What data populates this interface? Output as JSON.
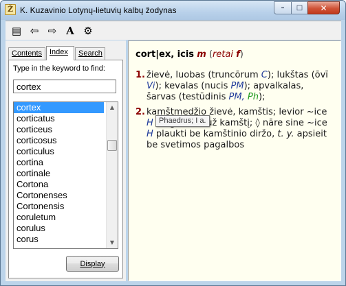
{
  "window": {
    "title": "K. Kuzavinio Lotynų-lietuvių kalbų žodynas",
    "icon_glyph": "Ž",
    "controls": {
      "minimize": "–",
      "maximize": "□",
      "close": "✕"
    }
  },
  "toolbar": [
    {
      "name": "toggle-pane-icon",
      "glyph": "▤"
    },
    {
      "name": "back-arrow-icon",
      "glyph": "⇦"
    },
    {
      "name": "forward-arrow-icon",
      "glyph": "⇨"
    },
    {
      "name": "font-size-icon",
      "glyph": "A"
    },
    {
      "name": "options-icon",
      "glyph": "⚙"
    }
  ],
  "tabs": {
    "contents": "Contents",
    "index": "Index",
    "search": "Search"
  },
  "index": {
    "prompt": "Type in the keyword to find:",
    "keyword_value": "cortex",
    "items": [
      "cortex",
      "corticatus",
      "corticeus",
      "corticosus",
      "corticulus",
      "cortina",
      "cortinale",
      "Cortona",
      "Cortonenses",
      "Cortonensis",
      "coruletum",
      "corulus",
      "corus"
    ],
    "selected_index": 0,
    "display_label": "Display"
  },
  "entry": {
    "headword": "cort|ex, icis",
    "gender": "m",
    "paren_open": "(",
    "paren_word": "retai",
    "paren_gender": "f",
    "paren_close": ")",
    "senses": [
      {
        "num": "1.",
        "text_a": "žievė, luobas (truncōrum ",
        "auth_a": "C",
        "text_b": "); lukštas (ōvī ",
        "auth_b": "Vi",
        "text_c": "); kevalas (nucis ",
        "auth_c": "PM",
        "text_d": "); apvalkalas, šarvas (testūdinis ",
        "auth_d": "PM,",
        "auth_e": "Ph",
        "text_e": ");"
      },
      {
        "num": "2.",
        "text_a": "kamštmedžio žievė, kamštis; levior ~ice ",
        "auth_a": "H",
        "text_b": " lengvesnis už kamštį; ◊ nāre sine ~ice ",
        "auth_b": "H",
        "text_c": " plaukti be kamštinio diržo, ",
        "ital": "t. y.",
        "text_d": " apsieit be svetimos pagalbos"
      }
    ],
    "tooltip": "Phaedrus; I a."
  }
}
